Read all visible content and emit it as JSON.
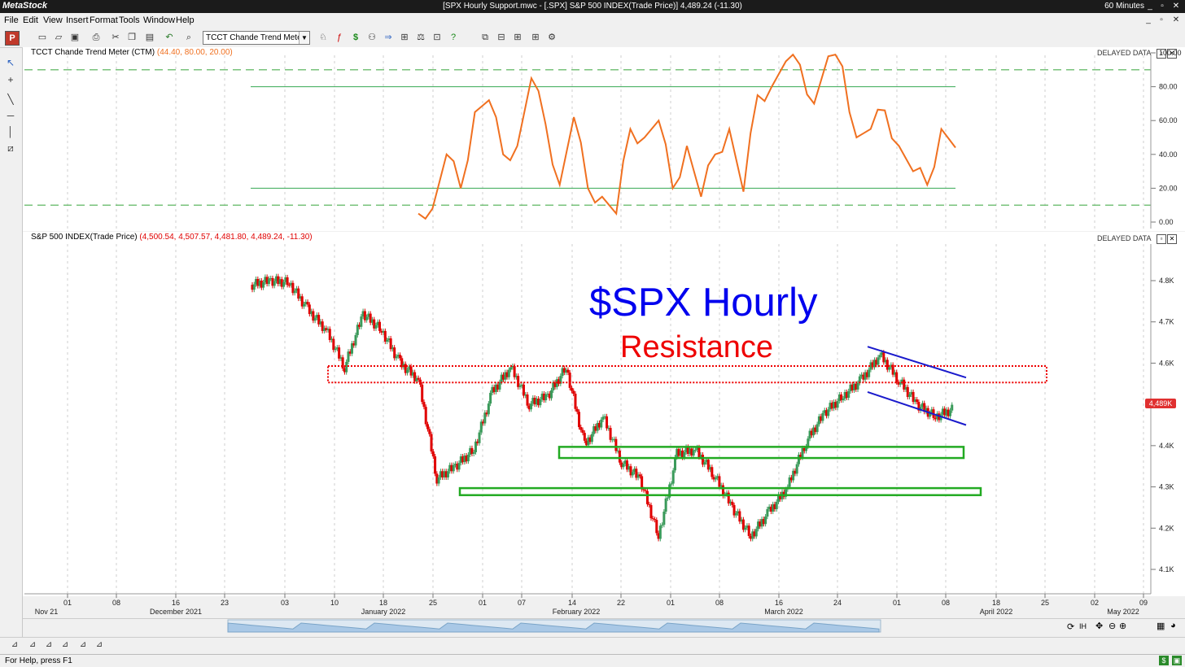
{
  "app": {
    "name": "MetaStock",
    "window_title": "[SPX Hourly Support.mwc - [.SPX] S&P 500 INDEX(Trade Price)]   4,489.24 (-11.30)",
    "interval": "60 Minutes",
    "window_buttons": [
      "_",
      "▫",
      "✕"
    ]
  },
  "menu": {
    "items": [
      "File",
      "Edit",
      "View",
      "Insert",
      "Format",
      "Tools",
      "Window",
      "Help"
    ],
    "mdi_buttons": [
      "_",
      "▫",
      "✕"
    ]
  },
  "toolbar": {
    "indicator_select": "TCCT Chande Trend Meter (",
    "icons": [
      "new-icon",
      "open-icon",
      "open-folder-icon",
      "save-icon",
      "print-icon",
      "cut-icon",
      "copy-icon",
      "paste-icon",
      "undo-icon",
      "zoom-icon",
      "indicator-icon",
      "expert-icon",
      "dollar-icon",
      "explorer-icon",
      "arrow-icon",
      "system-tester-icon",
      "forecaster-icon",
      "inspect-icon",
      "help-icon",
      "layout-1-icon",
      "layout-2-icon",
      "layout-3-icon",
      "layout-4-icon",
      "settings-icon"
    ]
  },
  "left_tools": [
    "pointer-icon",
    "crosshair-icon",
    "trendline-icon",
    "horizontal-line-icon",
    "vertical-line-icon",
    "fibonacci-icon"
  ],
  "panes": {
    "indicator": {
      "label": "TCCT Chande Trend Meter (CTM)",
      "params": "(44.40, 80.00, 20.00)",
      "delayed": "DELAYED DATA",
      "y_ticks": [
        "100.00",
        "80.00",
        "60.00",
        "40.00",
        "20.00",
        "0.00"
      ]
    },
    "price": {
      "label": "S&P 500 INDEX(Trade Price)",
      "params": "(4,500.54, 4,507.57, 4,481.80, 4,489.24, -11.30)",
      "delayed": "DELAYED DATA",
      "y_ticks": [
        "4.8K",
        "4.7K",
        "4.6K",
        "4.5K",
        "4.4K",
        "4.3K",
        "4.2K",
        "4.1K"
      ],
      "last_value": "4,489K",
      "annotation_title": "$SPX Hourly",
      "annotation_resistance": "Resistance"
    }
  },
  "x_axis": {
    "day_ticks": [
      "01",
      "08",
      "16",
      "23",
      "03",
      "10",
      "18",
      "25",
      "01",
      "07",
      "14",
      "22",
      "01",
      "08",
      "16",
      "24",
      "01",
      "08",
      "18",
      "25",
      "02",
      "09"
    ],
    "month_labels": [
      "Nov 21",
      "December 2021",
      "January 2022",
      "February 2022",
      "March 2022",
      "April 2022",
      "May 2022"
    ]
  },
  "status": {
    "help_text": "For Help, press F1",
    "right_icons": [
      "dollar-status-icon",
      "lock-status-icon"
    ]
  },
  "colors": {
    "ctm_line": "#f07020",
    "ctm_levels": "#34a853",
    "ctm_guides": "#4caf50",
    "candle_up": "#3a9a5a",
    "candle_down": "#e00000",
    "resistance": "#ee0000",
    "support": "#22aa22",
    "channel": "#1a1acc",
    "title_annotation": "#0000ee"
  },
  "chart_data": [
    {
      "type": "line",
      "title": "TCCT Chande Trend Meter (CTM)",
      "ylim": [
        0,
        100
      ],
      "reference_lines": [
        90,
        80,
        20,
        10
      ],
      "series": [
        {
          "name": "CTM",
          "x": [
            "Dec 28",
            "Dec 30",
            "Jan 03",
            "Jan 05",
            "Jan 07",
            "Jan 10",
            "Jan 12",
            "Jan 14",
            "Jan 18",
            "Jan 20",
            "Jan 24",
            "Jan 26",
            "Jan 28",
            "Feb 01",
            "Feb 03",
            "Feb 07",
            "Feb 09",
            "Feb 11",
            "Feb 14",
            "Feb 16",
            "Feb 18",
            "Feb 22",
            "Feb 24",
            "Feb 28",
            "Mar 02",
            "Mar 04",
            "Mar 08",
            "Mar 10",
            "Mar 14",
            "Mar 16",
            "Mar 18",
            "Mar 22",
            "Mar 24",
            "Mar 28",
            "Mar 30",
            "Apr 01",
            "Apr 05",
            "Apr 07",
            "Apr 11"
          ],
          "values": [
            5,
            8,
            40,
            20,
            65,
            72,
            40,
            45,
            85,
            58,
            22,
            62,
            20,
            15,
            5,
            55,
            50,
            60,
            20,
            45,
            15,
            40,
            55,
            18,
            75,
            80,
            95,
            93,
            70,
            98,
            92,
            50,
            55,
            66,
            45,
            30,
            22,
            55,
            44
          ]
        }
      ]
    },
    {
      "type": "candlestick",
      "title": "S&P 500 INDEX(Trade Price)",
      "ylim": [
        4080,
        4880
      ],
      "series": [
        {
          "name": "S&P 500 INDEX",
          "x": [
            "Dec 28",
            "Dec 30",
            "Jan 03",
            "Jan 05",
            "Jan 07",
            "Jan 10",
            "Jan 12",
            "Jan 14",
            "Jan 18",
            "Jan 20",
            "Jan 24",
            "Jan 26",
            "Jan 28",
            "Feb 01",
            "Feb 03",
            "Feb 07",
            "Feb 09",
            "Feb 11",
            "Feb 14",
            "Feb 16",
            "Feb 18",
            "Feb 22",
            "Feb 24",
            "Feb 28",
            "Mar 02",
            "Mar 04",
            "Mar 08",
            "Mar 10",
            "Mar 14",
            "Mar 16",
            "Mar 18",
            "Mar 22",
            "Mar 24",
            "Mar 28",
            "Mar 30",
            "Apr 01",
            "Apr 05",
            "Apr 07",
            "Apr 11"
          ],
          "values": [
            4790,
            4800,
            4795,
            4730,
            4680,
            4590,
            4720,
            4680,
            4600,
            4560,
            4320,
            4350,
            4390,
            4530,
            4590,
            4500,
            4520,
            4590,
            4400,
            4470,
            4360,
            4320,
            4180,
            4380,
            4390,
            4330,
            4250,
            4180,
            4240,
            4300,
            4410,
            4480,
            4520,
            4560,
            4620,
            4560,
            4500,
            4470,
            4489
          ]
        }
      ],
      "annotations": {
        "resistance_zone": [
          4553,
          4593
        ],
        "support_zones": [
          [
            4370,
            4397
          ],
          [
            4280,
            4297
          ]
        ],
        "channel_upper": [
          [
            "Mar 29",
            4640
          ],
          [
            "Apr 08",
            4565
          ]
        ],
        "channel_lower": [
          [
            "Mar 29",
            4530
          ],
          [
            "Apr 08",
            4450
          ]
        ]
      }
    }
  ]
}
